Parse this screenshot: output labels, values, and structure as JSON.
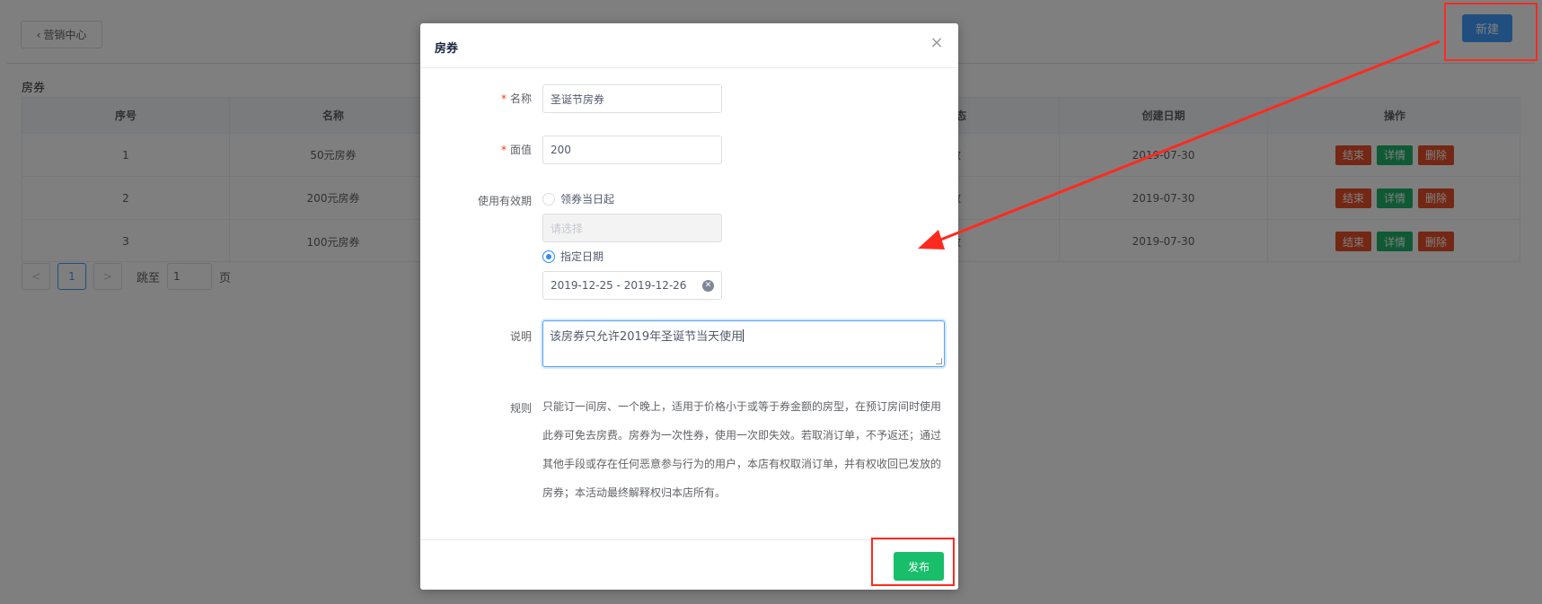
{
  "header": {
    "back_label": "营销中心",
    "new_label": "新建"
  },
  "section": {
    "title": "房券"
  },
  "table": {
    "columns": [
      "序号",
      "名称",
      "",
      "",
      "状态",
      "创建日期",
      "操作"
    ],
    "rows": [
      {
        "index": "1",
        "name": "50元房券",
        "status_fragment": "效",
        "date": "2019-07-30"
      },
      {
        "index": "2",
        "name": "200元房券",
        "status_fragment": "效",
        "date": "2019-07-30"
      },
      {
        "index": "3",
        "name": "100元房券",
        "status_fragment": "效",
        "date": "2019-07-30"
      }
    ],
    "ops": {
      "end": "结束",
      "detail": "详情",
      "delete": "删除"
    }
  },
  "pagination": {
    "prev": "<",
    "current": "1",
    "next": ">",
    "jump_label": "跳至",
    "jump_value": "1",
    "page_label": "页"
  },
  "dialog": {
    "title": "房券",
    "close": "×",
    "name_label": "名称",
    "name_value": "圣诞节房券",
    "value_label": "面值",
    "value_value": "200",
    "validity_label": "使用有效期",
    "option_from_receive": "领券当日起",
    "select_placeholder": "请选择",
    "option_specified": "指定日期",
    "date_range": "2019-12-25 - 2019-12-26",
    "desc_label": "说明",
    "desc_value": "该房券只允许2019年圣诞节当天使用",
    "rules_label": "规则",
    "rules_text": "只能订一间房、一个晚上，适用于价格小于或等于券金额的房型，在预订房间时使用此券可免去房费。房券为一次性券，使用一次即失效。若取消订单，不予返还；通过其他手段或存在任何恶意参与行为的用户，本店有权取消订单，并有权收回已发放的房券；本活动最终解释权归本店所有。",
    "publish_label": "发布"
  },
  "colors": {
    "primary": "#409eff",
    "success": "#19be6b",
    "danger": "#e6502b",
    "annotation": "#ff2a1f",
    "overlay": "rgba(0,0,0,0.5)"
  }
}
